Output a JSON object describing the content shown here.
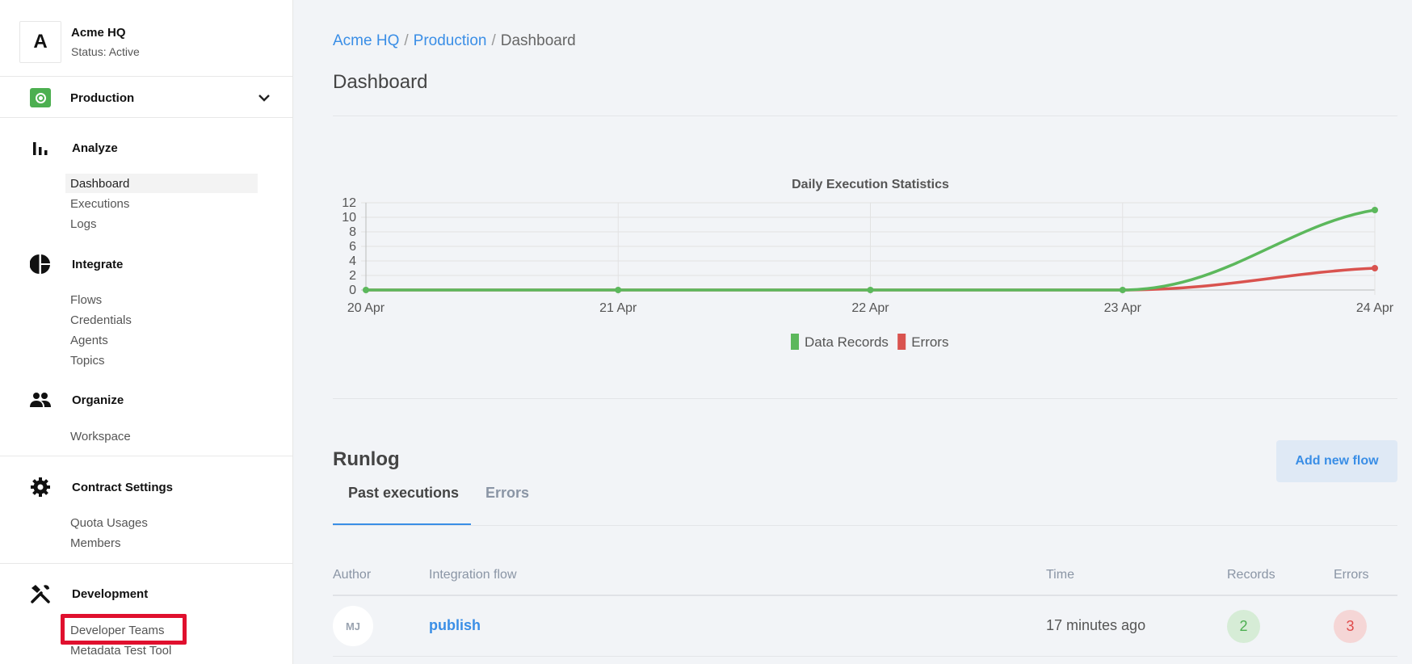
{
  "org": {
    "avatar_letter": "A",
    "name": "Acme HQ",
    "status": "Status: Active"
  },
  "environment": {
    "label": "Production",
    "accent_color": "#4caf50"
  },
  "sidebar": {
    "sections": [
      {
        "label": "Analyze",
        "icon": "bar-chart-icon",
        "items": [
          "Dashboard",
          "Executions",
          "Logs"
        ],
        "active": "Dashboard"
      },
      {
        "label": "Integrate",
        "icon": "pie-chart-icon",
        "items": [
          "Flows",
          "Credentials",
          "Agents",
          "Topics"
        ]
      },
      {
        "label": "Organize",
        "icon": "people-icon",
        "items": [
          "Workspace"
        ]
      },
      {
        "label": "Contract Settings",
        "icon": "gear-icon",
        "items": [
          "Quota Usages",
          "Members"
        ]
      },
      {
        "label": "Development",
        "icon": "tools-icon",
        "items": [
          "Developer Teams",
          "Metadata Test Tool"
        ],
        "highlighted": "Developer Teams"
      }
    ]
  },
  "breadcrumb": {
    "org": "Acme HQ",
    "env": "Production",
    "current": "Dashboard",
    "separator": "/"
  },
  "page": {
    "title": "Dashboard"
  },
  "chart_data": {
    "type": "line",
    "title": "Daily Execution Statistics",
    "categories": [
      "20 Apr",
      "21 Apr",
      "22 Apr",
      "23 Apr",
      "24 Apr"
    ],
    "series": [
      {
        "name": "Data Records",
        "values": [
          0,
          0,
          0,
          0,
          11
        ],
        "color": "#5cb85c"
      },
      {
        "name": "Errors",
        "values": [
          0,
          0,
          0,
          0,
          3
        ],
        "color": "#d9534f"
      }
    ],
    "y_ticks": [
      0,
      2,
      4,
      6,
      8,
      10,
      12
    ],
    "ylim": [
      0,
      12
    ],
    "grid": true,
    "legend_position": "bottom"
  },
  "runlog": {
    "title": "Runlog",
    "add_button": "Add new flow",
    "tabs": [
      "Past executions",
      "Errors"
    ],
    "columns": [
      "Author",
      "Integration flow",
      "Time",
      "Records",
      "Errors"
    ],
    "rows": [
      {
        "author": "MJ",
        "flow": "publish",
        "time": "17 minutes ago",
        "records": "2",
        "errors": "3"
      }
    ]
  }
}
